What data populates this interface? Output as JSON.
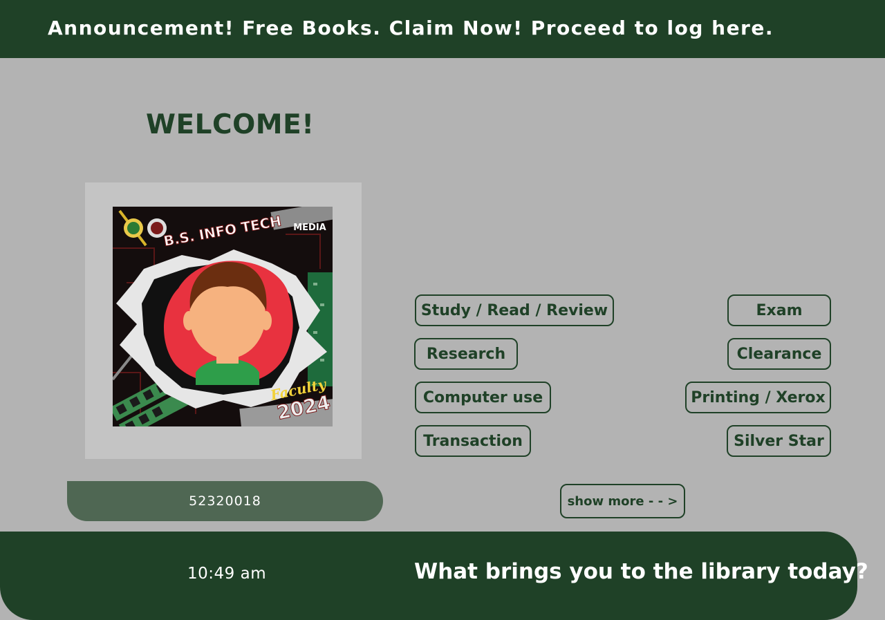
{
  "announcement": "Announcement! Free Books. Claim Now! Proceed to log here.",
  "welcome": "WELCOME!",
  "photo": {
    "badge_title": "B.S. INFO TECH",
    "badge_media": "MEDIA",
    "badge_caption": "Faculty",
    "badge_year": "2024"
  },
  "user_id": "52320018",
  "purposes": {
    "study": "Study / Read / Review",
    "exam": "Exam",
    "research": "Research",
    "clearance": "Clearance",
    "computer": "Computer use",
    "printing": "Printing / Xerox",
    "transaction": "Transaction",
    "silver": "Silver Star"
  },
  "show_more": "show more - - >",
  "clock": "10:49 am",
  "question": "What brings you to the library today?",
  "colors": {
    "primary": "#1f4127",
    "background": "#b3b3b3",
    "id_pill": "#4f6753",
    "avatar_red": "#e8323f",
    "shirt_green": "#2e9e4a"
  }
}
